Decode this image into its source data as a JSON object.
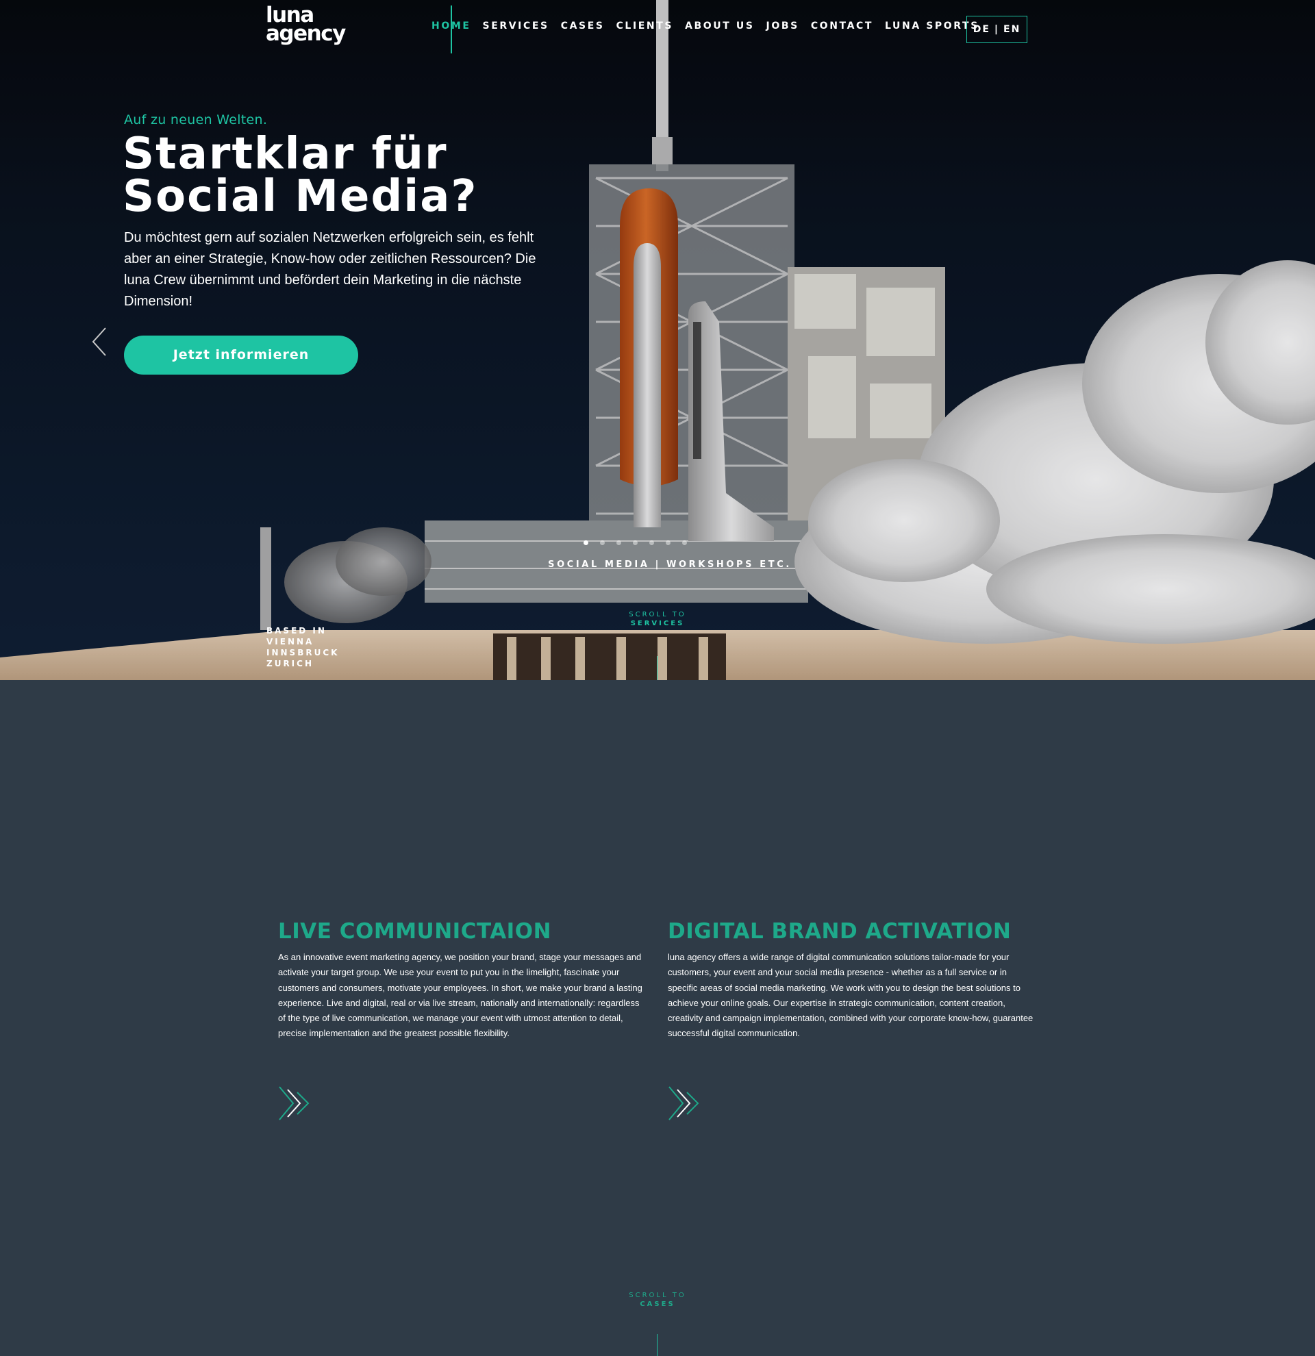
{
  "header": {
    "logo_line1": "luna",
    "logo_line2": "agency",
    "nav": [
      {
        "label": "HOME"
      },
      {
        "label": "SERVICES"
      },
      {
        "label": "CASES"
      },
      {
        "label": "CLIENTS"
      },
      {
        "label": "ABOUT US"
      },
      {
        "label": "JOBS"
      },
      {
        "label": "CONTACT"
      },
      {
        "label": "LUNA SPORTS"
      }
    ],
    "lang_de": "DE",
    "lang_sep": "|",
    "lang_en": "EN"
  },
  "hero": {
    "eyebrow": "Auf zu neuen Welten.",
    "headline_line1": "Startklar für",
    "headline_line2": "Social Media?",
    "lead": "Du möchtest gern auf sozialen Netzwerken erfolgreich sein, es fehlt aber an einer Strategie, Know-how oder zeitlichen Ressourcen? Die luna Crew übernimmt und befördert dein Marketing in die nächste Dimension!",
    "cta_label": "Jetzt informieren",
    "slide_tags": "SOCIAL MEDIA | WORKSHOPS ETC.",
    "slides_total": 7,
    "slide_active": 1,
    "based_label": "BASED IN",
    "cities": [
      "VIENNA",
      "INNSBRUCK",
      "ZURICH"
    ],
    "scroll_label": "SCROLL TO",
    "scroll_target": "SERVICES"
  },
  "services": [
    {
      "title": "LIVE COMMUNICTAION",
      "text": "As an innovative event marketing agency, we position your brand, stage your messages and activate your target group. We use your event to put you in the limelight, fascinate your customers and consumers, motivate your employees. In short, we make your brand a lasting experience. Live and digital, real or via live stream, nationally and internationally: regardless of the type of live communication, we manage your event with utmost attention to detail, precise implementation and the greatest possible flexibility."
    },
    {
      "title": "DIGITAL BRAND ACTIVATION",
      "text": "luna agency offers a wide range of digital communication solutions tailor-made for your customers, your event and your social media presence - whether as a full service or in specific areas of social media marketing. We work with you to design the best solutions to achieve your online goals. Our expertise in strategic communication, content creation, creativity and campaign implementation, combined with your corporate know-how, guarantee successful digital communication."
    }
  ],
  "scroll2": {
    "label": "SCROLL TO",
    "target": "CASES"
  },
  "colors": {
    "accent": "#1ec4a3",
    "section_bg": "#2f3b47",
    "heading_green": "#1ea98a"
  }
}
